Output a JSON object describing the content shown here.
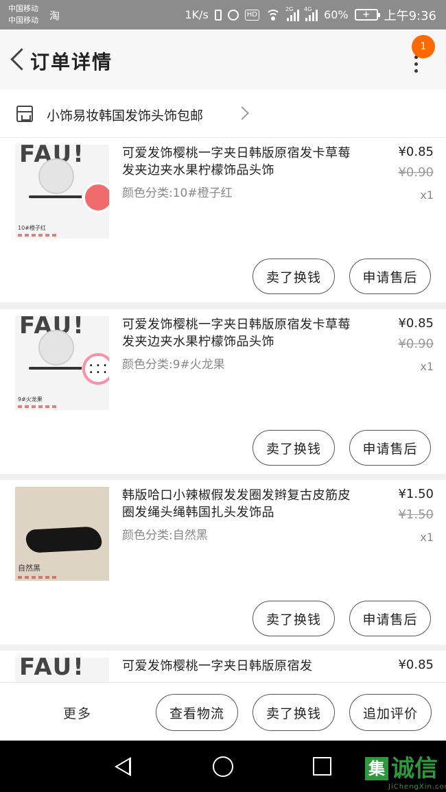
{
  "status_bar": {
    "carrier1": "中国移动",
    "carrier2": "中国移动",
    "taobao_icon": "淘",
    "speed": "1K/s",
    "hd": "HD",
    "net2g": "2G",
    "net4g": "4G",
    "battery_pct": "60%",
    "time": "上午9:36"
  },
  "header": {
    "title": "订单详情",
    "badge_count": "1"
  },
  "shop": {
    "name": "小饰易妆韩国发饰头饰包邮"
  },
  "items": [
    {
      "title": "可爱发饰樱桃一字夹日韩版原宿发卡草莓发夹边夹水果柠檬饰品头饰",
      "variant": "颜色分类:10#橙子红",
      "price": "¥0.85",
      "original_price": "¥0.90",
      "quantity": "x1",
      "thumb_tag": "10#橙子红",
      "thumb_text": "FAU!"
    },
    {
      "title": "可爱发饰樱桃一字夹日韩版原宿发卡草莓发夹边夹水果柠檬饰品头饰",
      "variant": "颜色分类:9#火龙果",
      "price": "¥0.85",
      "original_price": "¥0.90",
      "quantity": "x1",
      "thumb_tag": "9#火龙果",
      "thumb_text": "FAU!"
    },
    {
      "title": "韩版哈口小辣椒假发发圈发辫复古皮筋皮圈发绳头绳韩国扎头发饰品",
      "variant": "颜色分类:自然黑",
      "price": "¥1.50",
      "original_price": "¥1.50",
      "quantity": "x1",
      "thumb_tag": "自然黑"
    },
    {
      "title": "可爱发饰樱桃一字夹日韩版原宿发",
      "price": "¥0.85",
      "thumb_text": "FAU!"
    }
  ],
  "item_actions": {
    "sell_label": "卖了换钱",
    "after_sale_label": "申请售后"
  },
  "bottom_bar": {
    "more_label": "更多",
    "logistics_label": "查看物流",
    "sell_label": "卖了换钱",
    "review_label": "追加评价"
  },
  "watermark": {
    "brand": "诚信",
    "box_char": "集",
    "domain": "JiChengXin.com",
    "color": "#2c9a3c"
  },
  "colors": {
    "accent": "#ff6a00",
    "status_bar": "#8c8c8c"
  }
}
